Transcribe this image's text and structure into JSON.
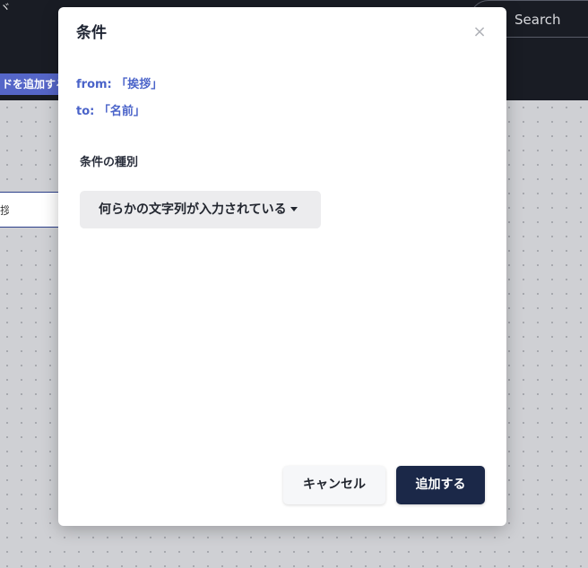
{
  "header": {
    "glyph": "ヾ",
    "search_label": "Search",
    "add_node_label": "ドを追加する"
  },
  "canvas": {
    "node_label": "拶"
  },
  "modal": {
    "title": "条件",
    "close_symbol": "×",
    "from_text": "from: 「挨拶」",
    "to_text": "to: 「名前」",
    "condition_type_label": "条件の種別",
    "condition_selected": "何らかの文字列が入力されている",
    "cancel_label": "キャンセル",
    "add_label": "追加する"
  },
  "colors": {
    "header_bg": "#191c24",
    "accent_link": "#4a63c9",
    "primary_button": "#1b2848",
    "add_node_button": "#5566c8"
  }
}
